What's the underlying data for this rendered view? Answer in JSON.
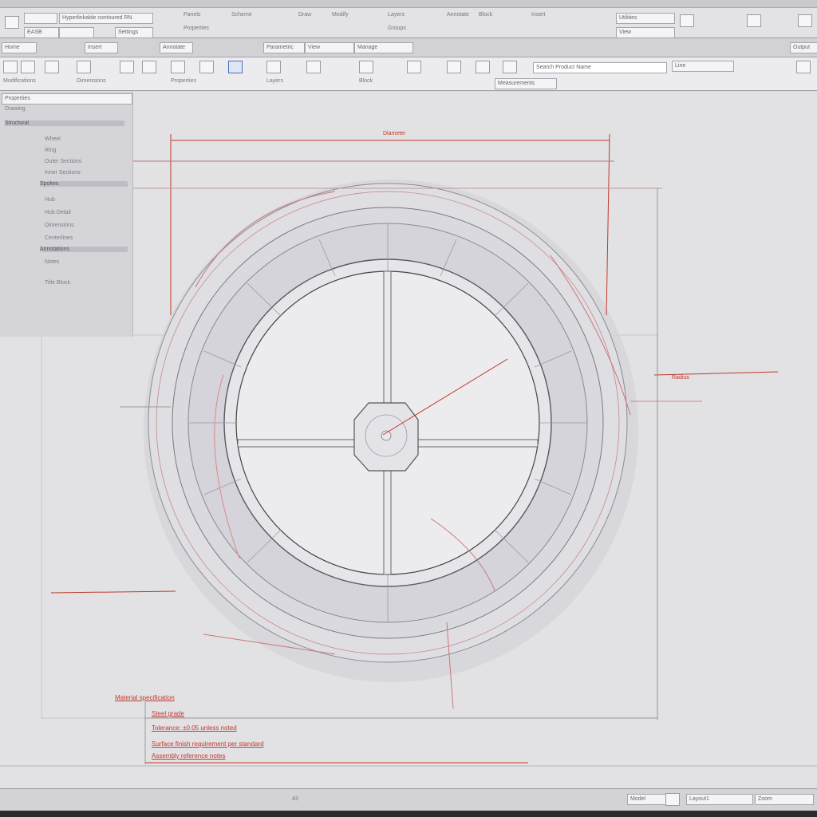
{
  "app": {
    "ribbon_fields": [
      "Hyperlinkable contoured RN",
      "EASB",
      "Settings"
    ],
    "ribbon_labels": [
      "Panels",
      "Scheme",
      "Draw",
      "Modify",
      "Layers",
      "Annotate",
      "Block",
      "Insert",
      "Properties",
      "Groups",
      "Utilities",
      "View"
    ],
    "tabs": [
      "Home",
      "Insert",
      "Annotate",
      "Parametric",
      "View",
      "Manage",
      "Output"
    ],
    "tool_groups": [
      "Modifications",
      "Dimensions",
      "Properties",
      "Layers",
      "Block",
      "Measurements"
    ],
    "tool_search": "Search Product Name",
    "tool_field": "Line"
  },
  "panel": {
    "title": "Properties",
    "items": [
      "Drawing",
      "Structural",
      "Wheel",
      "Ring",
      "Outer Sections",
      "Inner Sections",
      "Spokes",
      "Hub",
      "Hub Detail",
      "Dimensions",
      "Centerlines",
      "Annotations",
      "Notes",
      "Title Block"
    ]
  },
  "drawing": {
    "dim_top": "Diameter",
    "dim_right": "Radius",
    "notes": [
      "Material specification",
      "Steel grade",
      "Tolerance: ±0.05 unless noted",
      "Surface finish requirement per standard",
      "Assembly reference notes"
    ]
  },
  "status": {
    "center_text": "43",
    "model_button": "Model",
    "layout_text": "Layout1",
    "zoom_text": "Zoom"
  },
  "colors": {
    "accent": "#c0392b",
    "line": "#6b6b72",
    "canvas": "#e2e2e5"
  }
}
